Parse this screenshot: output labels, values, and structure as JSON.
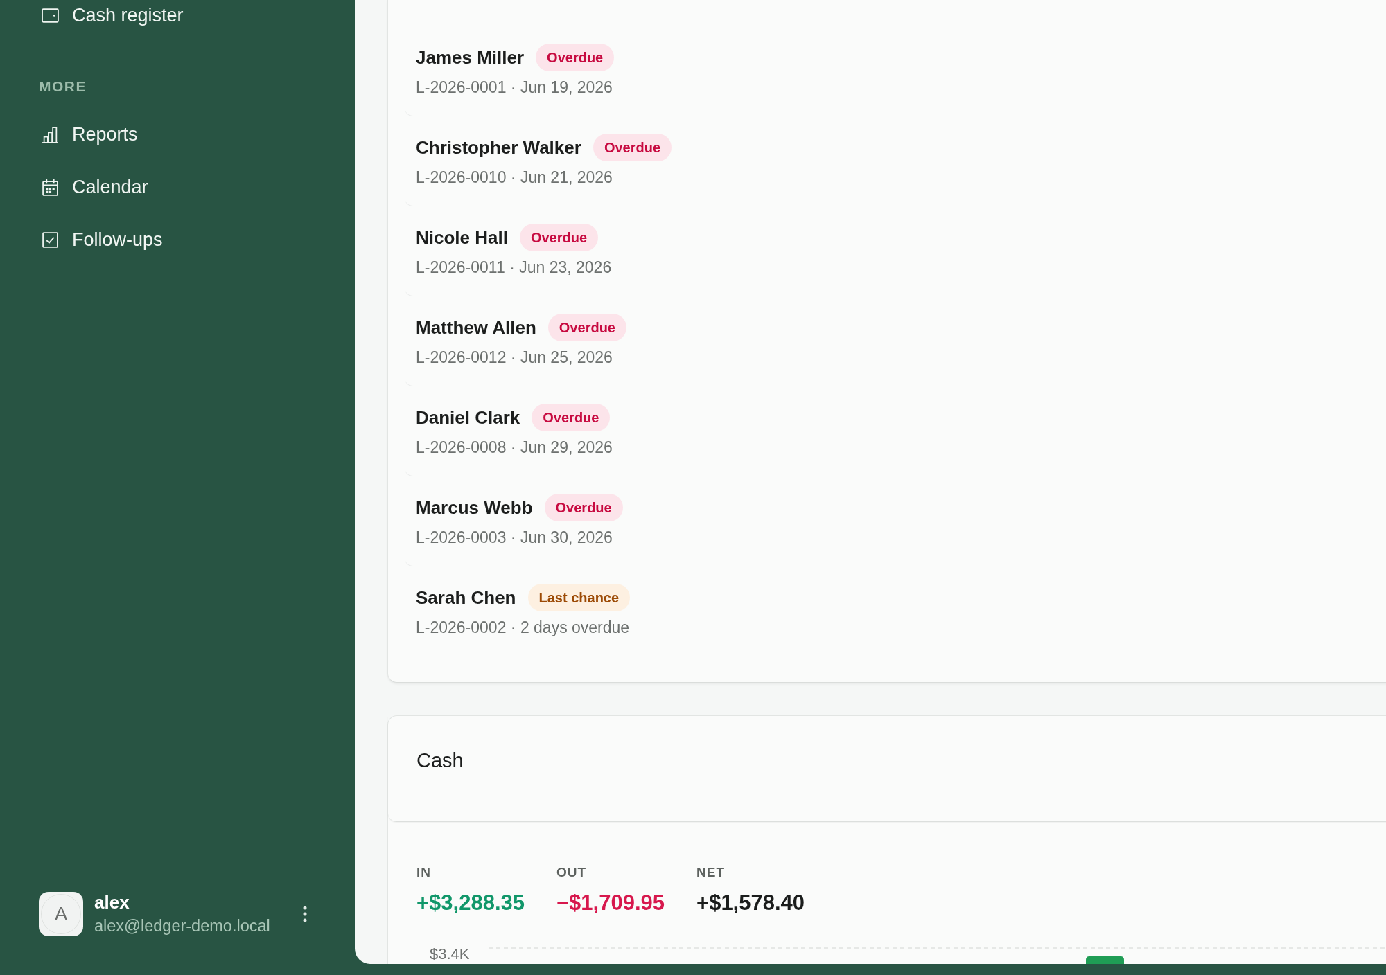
{
  "sidebar": {
    "nav_items": [
      {
        "kind": "register",
        "label": "Cash register",
        "selected": false
      }
    ],
    "more_section": {
      "title": "MORE",
      "items": [
        {
          "kind": "reports",
          "label": "Reports",
          "selected": false
        },
        {
          "kind": "calendar",
          "label": "Calendar",
          "selected": false
        },
        {
          "kind": "followups",
          "label": "Follow-ups",
          "selected": false
        }
      ]
    },
    "user": {
      "initial": "A",
      "name": "alex",
      "email": "alex@ledger-demo.local"
    }
  },
  "loans_card": {
    "rows": [
      {
        "name": "James Miller",
        "badge": {
          "kind": "overdue",
          "label": "Overdue"
        },
        "meta": "L-2026-0001 · Jun 19, 2026"
      },
      {
        "name": "Christopher Walker",
        "badge": {
          "kind": "overdue",
          "label": "Overdue"
        },
        "meta": "L-2026-0010 · Jun 21, 2026"
      },
      {
        "name": "Nicole Hall",
        "badge": {
          "kind": "overdue",
          "label": "Overdue"
        },
        "meta": "L-2026-0011 · Jun 23, 2026"
      },
      {
        "name": "Matthew Allen",
        "badge": {
          "kind": "overdue",
          "label": "Overdue"
        },
        "meta": "L-2026-0012 · Jun 25, 2026"
      },
      {
        "name": "Daniel Clark",
        "badge": {
          "kind": "overdue",
          "label": "Overdue"
        },
        "meta": "L-2026-0008 · Jun 29, 2026"
      },
      {
        "name": "Marcus Webb",
        "badge": {
          "kind": "overdue",
          "label": "Overdue"
        },
        "meta": "L-2026-0003 · Jun 30, 2026"
      },
      {
        "name": "Sarah Chen",
        "badge": {
          "kind": "last_chance",
          "label": "Last chance"
        },
        "meta": "L-2026-0002 · 2 days overdue"
      }
    ]
  },
  "cash": {
    "title": "Cash",
    "stats": [
      {
        "kind": "in",
        "label": "IN",
        "value": "+$3,288.35"
      },
      {
        "kind": "out",
        "label": "OUT",
        "value": "−$1,709.95"
      },
      {
        "kind": "net",
        "label": "NET",
        "value": "+$1,578.40"
      }
    ],
    "chart": {
      "y_tick": "$3.4K"
    }
  }
}
